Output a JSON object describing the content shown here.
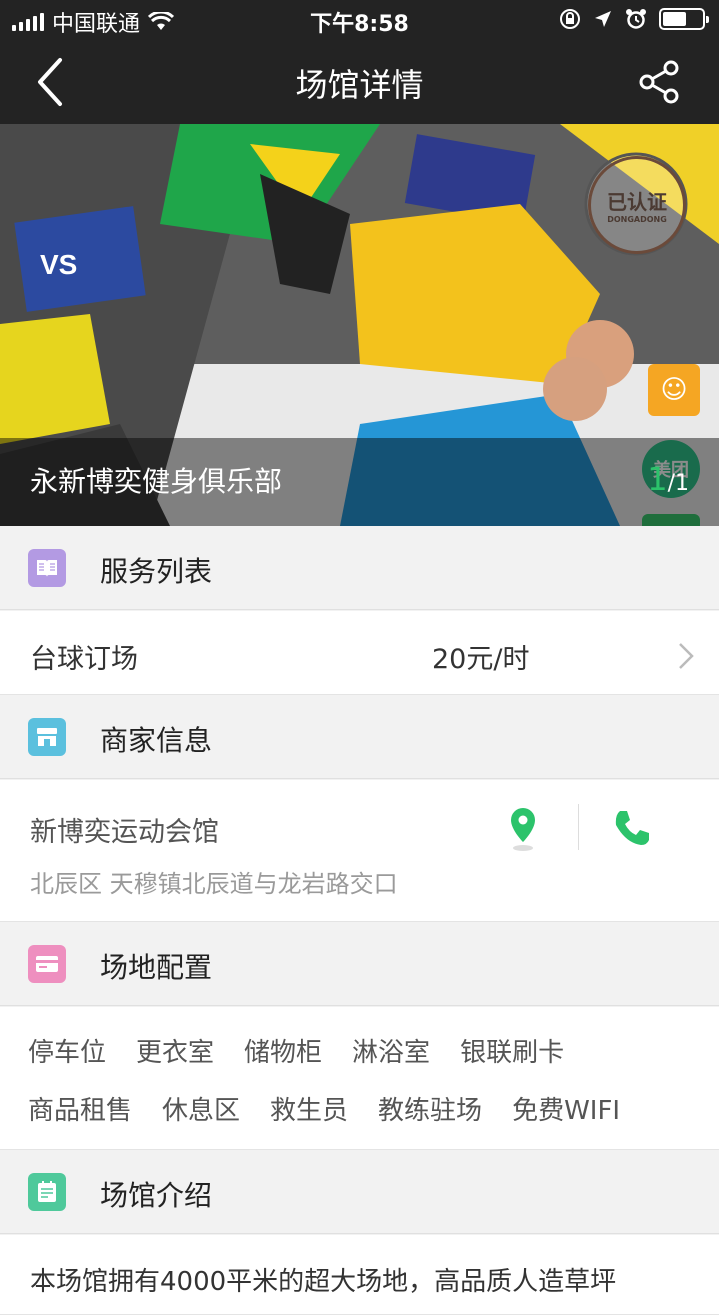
{
  "status_bar": {
    "carrier": "中国联通",
    "time": "下午8:58",
    "battery_level": 0.6
  },
  "nav": {
    "title": "场馆详情",
    "back_icon": "chevron-left-icon",
    "share_icon": "share-icon"
  },
  "hero": {
    "venue_name": "永新博奕健身俱乐部",
    "page_current": "1",
    "page_total": "/1",
    "badges": [
      "已认证",
      "DONGADONG",
      "美团"
    ]
  },
  "sections": {
    "services": {
      "label": "服务列表",
      "icon": "book-icon",
      "color": "#b39ae3"
    },
    "merchant": {
      "label": "商家信息",
      "icon": "store-icon",
      "color": "#5bc0de"
    },
    "facilities": {
      "label": "场地配置",
      "icon": "card-icon",
      "color": "#ee8fbf"
    },
    "intro": {
      "label": "场馆介绍",
      "icon": "note-icon",
      "color": "#4fc99b"
    }
  },
  "service": {
    "name": "台球订场",
    "price": "20元/时"
  },
  "merchant": {
    "name": "新博奕运动会馆",
    "address": "北辰区 天穆镇北辰道与龙岩路交口"
  },
  "facilities": {
    "row1": [
      "停车位",
      "更衣室",
      "储物柜",
      "淋浴室",
      "银联刷卡"
    ],
    "row2": [
      "商品租售",
      "休息区",
      "救生员",
      "教练驻场",
      "免费WIFI"
    ]
  },
  "intro": {
    "text": "本场馆拥有4000平米的超大场地，高品质人造草坪"
  },
  "colors": {
    "accent_green": "#2cc36b",
    "bar_dark": "#232323"
  }
}
